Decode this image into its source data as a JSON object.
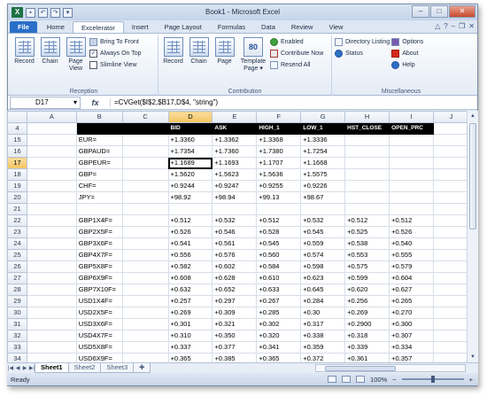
{
  "window": {
    "title": "Book1 - Microsoft Excel",
    "logo": "X",
    "qat_icons": [
      "save-icon",
      "undo-icon",
      "redo-icon",
      "customize-icon"
    ],
    "controls": {
      "minimize": "–",
      "maximize": "□",
      "close": "✕"
    }
  },
  "tabs": [
    "File",
    "Home",
    "Excelerator",
    "Insert",
    "Page Layout",
    "Formulas",
    "Data",
    "Review",
    "View"
  ],
  "active_tab": "Excelerator",
  "ribbon": {
    "reception": {
      "label": "Reception",
      "record": "Record",
      "chain": "Chain",
      "page_view_1": "Page",
      "page_view_2": "View",
      "bring_to_front": "Bring To Front",
      "always_on_top": "Always On Top",
      "slimline_view": "Slimline View"
    },
    "contribution": {
      "label": "Contribution",
      "record": "Record",
      "chain": "Chain",
      "page": "Page",
      "template_1": "Template",
      "template_2": "Page ▾",
      "template_icon_text": "80",
      "enabled": "Enabled",
      "contribute_now": "Contribute Now",
      "resend_all": "Resend All"
    },
    "misc": {
      "label": "Miscellaneous",
      "directory_listing": "Directory Listing",
      "status": "Status",
      "options": "Options",
      "about": "About",
      "help": "Help"
    }
  },
  "formula_bar": {
    "name_box": "D17",
    "fx": "fx",
    "formula": "=CVGet($I$2,$B17,D$4, \"string\")"
  },
  "grid": {
    "columns": [
      "A",
      "B",
      "C",
      "D",
      "E",
      "F",
      "G",
      "H",
      "I",
      "J",
      "K"
    ],
    "selected_column": "D",
    "selected_row": "17",
    "header_row": {
      "row": "4",
      "cells": [
        "",
        "",
        "",
        "BID",
        "ASK",
        "HIGH_1",
        "LOW_1",
        "HST_CLOSE",
        "OPEN_PRC",
        ""
      ]
    },
    "rows": [
      {
        "row": "15",
        "cells": [
          "",
          "EUR=",
          "",
          "+1.3360",
          "+1.3362",
          "+1.3368",
          "+1.3336",
          "",
          "",
          ""
        ]
      },
      {
        "row": "16",
        "cells": [
          "",
          "GBPAUD=",
          "",
          "+1.7354",
          "+1.7360",
          "+1.7380",
          "+1.7254",
          "",
          "",
          ""
        ]
      },
      {
        "row": "17",
        "cells": [
          "",
          "GBPEUR=",
          "",
          "+1.1689",
          "+1.1693",
          "+1.1707",
          "+1.1668",
          "",
          "",
          ""
        ]
      },
      {
        "row": "18",
        "cells": [
          "",
          "GBP=",
          "",
          "+1.5620",
          "+1.5623",
          "+1.5636",
          "+1.5575",
          "",
          "",
          ""
        ]
      },
      {
        "row": "19",
        "cells": [
          "",
          "CHF=",
          "",
          "+0.9244",
          "+0.9247",
          "+0.9255",
          "+0.9226",
          "",
          "",
          ""
        ]
      },
      {
        "row": "20",
        "cells": [
          "",
          "JPY=",
          "",
          "+98.92",
          "+98.94",
          "+99.13",
          "+98.67",
          "",
          "",
          ""
        ]
      },
      {
        "row": "21",
        "cells": [
          "",
          "",
          "",
          "",
          "",
          "",
          "",
          "",
          "",
          ""
        ]
      },
      {
        "row": "22",
        "cells": [
          "",
          "GBP1X4F=",
          "",
          "+0.512",
          "+0.532",
          "+0.512",
          "+0.532",
          "+0.512",
          "+0.512",
          ""
        ]
      },
      {
        "row": "23",
        "cells": [
          "",
          "GBP2X5F=",
          "",
          "+0.526",
          "+0.546",
          "+0.528",
          "+0.545",
          "+0.525",
          "+0.526",
          ""
        ]
      },
      {
        "row": "24",
        "cells": [
          "",
          "GBP3X6F=",
          "",
          "+0.541",
          "+0.561",
          "+0.545",
          "+0.559",
          "+0.538",
          "+0.540",
          ""
        ]
      },
      {
        "row": "25",
        "cells": [
          "",
          "GBP4X7F=",
          "",
          "+0.556",
          "+0.576",
          "+0.560",
          "+0.574",
          "+0.553",
          "+0.555",
          ""
        ]
      },
      {
        "row": "26",
        "cells": [
          "",
          "GBP5X8F=",
          "",
          "+0.582",
          "+0.602",
          "+0.584",
          "+0.598",
          "+0.575",
          "+0.579",
          ""
        ]
      },
      {
        "row": "27",
        "cells": [
          "",
          "GBP6X9F=",
          "",
          "+0.608",
          "+0.628",
          "+0.610",
          "+0.623",
          "+0.599",
          "+0.604",
          ""
        ]
      },
      {
        "row": "28",
        "cells": [
          "",
          "GBP7X10F=",
          "",
          "+0.632",
          "+0.652",
          "+0.633",
          "+0.645",
          "+0.620",
          "+0.627",
          ""
        ]
      },
      {
        "row": "29",
        "cells": [
          "",
          "USD1X4F=",
          "",
          "+0.257",
          "+0.297",
          "+0.267",
          "+0.284",
          "+0.256",
          "+0.265",
          ""
        ]
      },
      {
        "row": "30",
        "cells": [
          "",
          "USD2X5F=",
          "",
          "+0.269",
          "+0.309",
          "+0.285",
          "+0.30",
          "+0.269",
          "+0.270",
          ""
        ]
      },
      {
        "row": "31",
        "cells": [
          "",
          "USD3X6F=",
          "",
          "+0.301",
          "+0.321",
          "+0.302",
          "+0.317",
          "+0.2900",
          "+0.300",
          ""
        ]
      },
      {
        "row": "32",
        "cells": [
          "",
          "USD4X7F=",
          "",
          "+0.310",
          "+0.350",
          "+0.320",
          "+0.338",
          "+0.318",
          "+0.307",
          ""
        ]
      },
      {
        "row": "33",
        "cells": [
          "",
          "USD5X8F=",
          "",
          "+0.337",
          "+0.377",
          "+0.341",
          "+0.359",
          "+0.339",
          "+0.334",
          ""
        ]
      },
      {
        "row": "34",
        "cells": [
          "",
          "USD6X9F=",
          "",
          "+0.365",
          "+0.385",
          "+0.365",
          "+0.372",
          "+0.361",
          "+0.357",
          ""
        ]
      },
      {
        "row": "35",
        "cells": [
          "",
          "USD7X10F=",
          "",
          "+0.392",
          "+0.412",
          "+0.392",
          "+0.404",
          "+0.384",
          "+0.373",
          ""
        ]
      },
      {
        "row": "36",
        "cells": [
          "",
          "",
          "",
          "",
          "",
          "",
          "",
          "",
          "",
          ""
        ]
      },
      {
        "row": "37",
        "cells": [
          "",
          "",
          "",
          "",
          "",
          "",
          "",
          "",
          "",
          ""
        ]
      }
    ]
  },
  "sheet_tabs": [
    "Sheet1",
    "Sheet2",
    "Sheet3"
  ],
  "active_sheet": "Sheet1",
  "status": {
    "ready": "Ready",
    "zoom": "100%",
    "zoom_out": "−",
    "zoom_in": "+"
  }
}
